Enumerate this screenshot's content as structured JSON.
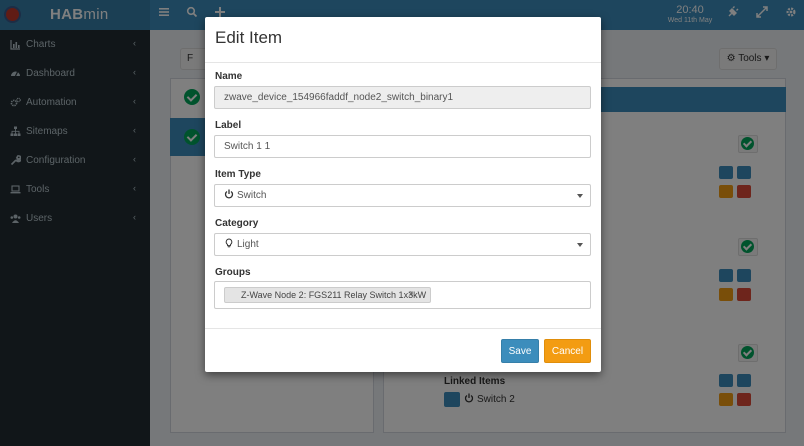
{
  "header": {
    "app_name_bold": "HAB",
    "app_name_rest": "min",
    "time": "20:40",
    "date": "Wed 11th May",
    "icons": [
      "menu-icon",
      "search-icon",
      "plus-icon",
      "plug-icon",
      "expand-icon",
      "gear-icon"
    ]
  },
  "sidebar": {
    "items": [
      {
        "label": "Charts",
        "icon": "bar-chart-icon"
      },
      {
        "label": "Dashboard",
        "icon": "dashboard-icon"
      },
      {
        "label": "Automation",
        "icon": "cogs-icon"
      },
      {
        "label": "Sitemaps",
        "icon": "sitemap-icon"
      },
      {
        "label": "Configuration",
        "icon": "wrench-icon"
      },
      {
        "label": "Tools",
        "icon": "laptop-icon"
      },
      {
        "label": "Users",
        "icon": "users-icon"
      }
    ]
  },
  "background": {
    "tools_label": "Tools",
    "filter_label": "F",
    "linked_items_title": "Linked Items",
    "linked_item_label": "Switch 2"
  },
  "modal": {
    "title": "Edit Item",
    "name_label": "Name",
    "name_value": "zwave_device_154966faddf_node2_switch_binary1",
    "label_label": "Label",
    "label_value": "Switch 1 1",
    "item_type_label": "Item Type",
    "item_type_value": "Switch",
    "category_label": "Category",
    "category_value": "Light",
    "groups_label": "Groups",
    "groups": [
      "Z-Wave Node 2: FGS211 Relay Switch 1x3kW"
    ],
    "save_label": "Save",
    "cancel_label": "Cancel"
  },
  "colors": {
    "header": "#3c8dbc",
    "sidebar": "#222d32",
    "primary": "#3c8dbc",
    "warning": "#f39c12",
    "danger": "#dd4b39",
    "success": "#00a65a"
  }
}
